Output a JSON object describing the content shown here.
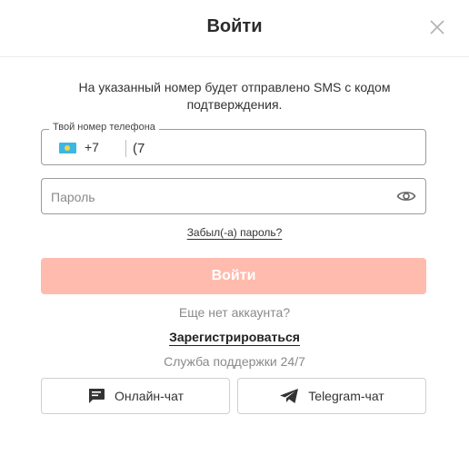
{
  "header": {
    "title": "Войти"
  },
  "info_text": "На указанный номер будет отправлено SMS с кодом подтверждения.",
  "phone": {
    "label": "Твой номер телефона",
    "country_code": "+7",
    "value": "(7",
    "flag_icon": "kazakhstan-flag-icon"
  },
  "password": {
    "placeholder": "Пароль"
  },
  "forgot_link": "Забыл(-а) пароль?",
  "submit_label": "Войти",
  "no_account_text": "Еще нет аккаунта?",
  "register_link": "Зарегистрироваться",
  "support_text": "Служба поддержки 24/7",
  "support_buttons": [
    {
      "label": "Онлайн-чат",
      "icon": "chat-icon"
    },
    {
      "label": "Telegram-чат",
      "icon": "telegram-icon"
    }
  ],
  "colors": {
    "submit_bg": "#ffbbad",
    "accent": "#f5593d"
  }
}
